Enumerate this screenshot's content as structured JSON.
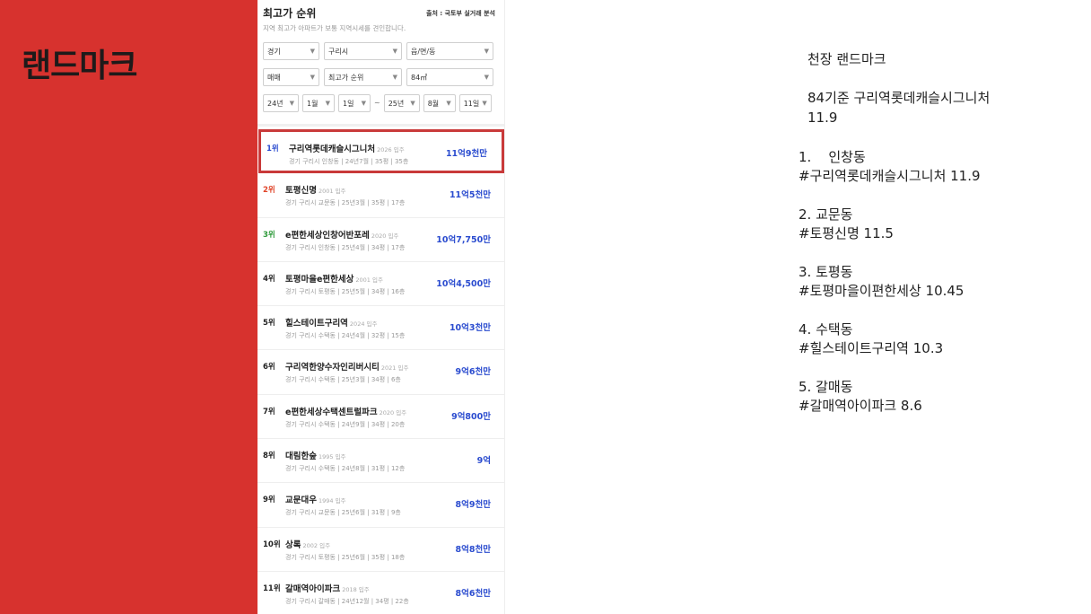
{
  "brand": {
    "logo_text": "랜드마크"
  },
  "phone": {
    "title": "최고가 순위",
    "source": "출처 : 국토부 실거래 분석",
    "subtitle": "지역 최고가 아파트가 보통 지역시세를 견인합니다.",
    "filters_row1": [
      "경기",
      "구리시",
      "읍/면/동"
    ],
    "filters_row2": [
      "매매",
      "최고가 순위",
      "84㎡"
    ],
    "date_from": [
      "24년",
      "1월",
      "1일"
    ],
    "date_sep": "~",
    "date_to": [
      "25년",
      "8월",
      "11일"
    ],
    "arrow": "▼",
    "items": [
      {
        "rank": "1위",
        "name": "구리역롯데캐슬시그니처",
        "year": "2026 입주",
        "info": "경기 구리시 인창동 | 24년7월 | 35평 | 35층",
        "price": "11억9천만"
      },
      {
        "rank": "2위",
        "name": "토평신명",
        "year": "2001 입주",
        "info": "경기 구리시 교문동 | 25년3월 | 35평 | 17층",
        "price": "11억5천만"
      },
      {
        "rank": "3위",
        "name": "e편한세상인창어반포레",
        "year": "2020 입주",
        "info": "경기 구리시 인창동 | 25년4월 | 34평 | 17층",
        "price": "10억7,750만"
      },
      {
        "rank": "4위",
        "name": "토평마을e편한세상",
        "year": "2001 입주",
        "info": "경기 구리시 토평동 | 25년5월 | 34평 | 16층",
        "price": "10억4,500만"
      },
      {
        "rank": "5위",
        "name": "힐스테이트구리역",
        "year": "2024 입주",
        "info": "경기 구리시 수택동 | 24년4월 | 32평 | 15층",
        "price": "10억3천만"
      },
      {
        "rank": "6위",
        "name": "구리역한양수자인리버시티",
        "year": "2021 입주",
        "info": "경기 구리시 수택동 | 25년3월 | 34평 | 6층",
        "price": "9억6천만"
      },
      {
        "rank": "7위",
        "name": "e편한세상수택센트럴파크",
        "year": "2020 입주",
        "info": "경기 구리시 수택동 | 24년9월 | 34평 | 20층",
        "price": "9억800만"
      },
      {
        "rank": "8위",
        "name": "대림한숲",
        "year": "1995 입주",
        "info": "경기 구리시 수택동 | 24년8월 | 31평 | 12층",
        "price": "9억"
      },
      {
        "rank": "9위",
        "name": "교문대우",
        "year": "1994 입주",
        "info": "경기 구리시 교문동 | 25년6월 | 31평 | 9층",
        "price": "8억9천만"
      },
      {
        "rank": "10위",
        "name": "상록",
        "year": "2002 입주",
        "info": "경기 구리시 토평동 | 25년6월 | 35평 | 18층",
        "price": "8억8천만"
      },
      {
        "rank": "11위",
        "name": "갈매역아이파크",
        "year": "2018 입주",
        "info": "경기 구리시 갈매동 | 24년12월 | 34평 | 22층",
        "price": "8억6천만"
      }
    ]
  },
  "notes": {
    "heading": "천장 랜드마크",
    "basis_line1": "84기준 구리역롯데캐슬시그니처",
    "basis_line2": "11.9",
    "entries": [
      {
        "line1": "1.    인창동",
        "line2": "#구리역롯데캐슬시그니처 11.9"
      },
      {
        "line1": "2. 교문동",
        "line2": "#토평신명 11.5"
      },
      {
        "line1": "3. 토평동",
        "line2": "#토평마을이편한세상 10.45"
      },
      {
        "line1": "4. 수택동",
        "line2": "#힐스테이트구리역 10.3"
      },
      {
        "line1": "5. 갈매동",
        "line2": "#갈매역아이파크 8.6"
      }
    ]
  }
}
